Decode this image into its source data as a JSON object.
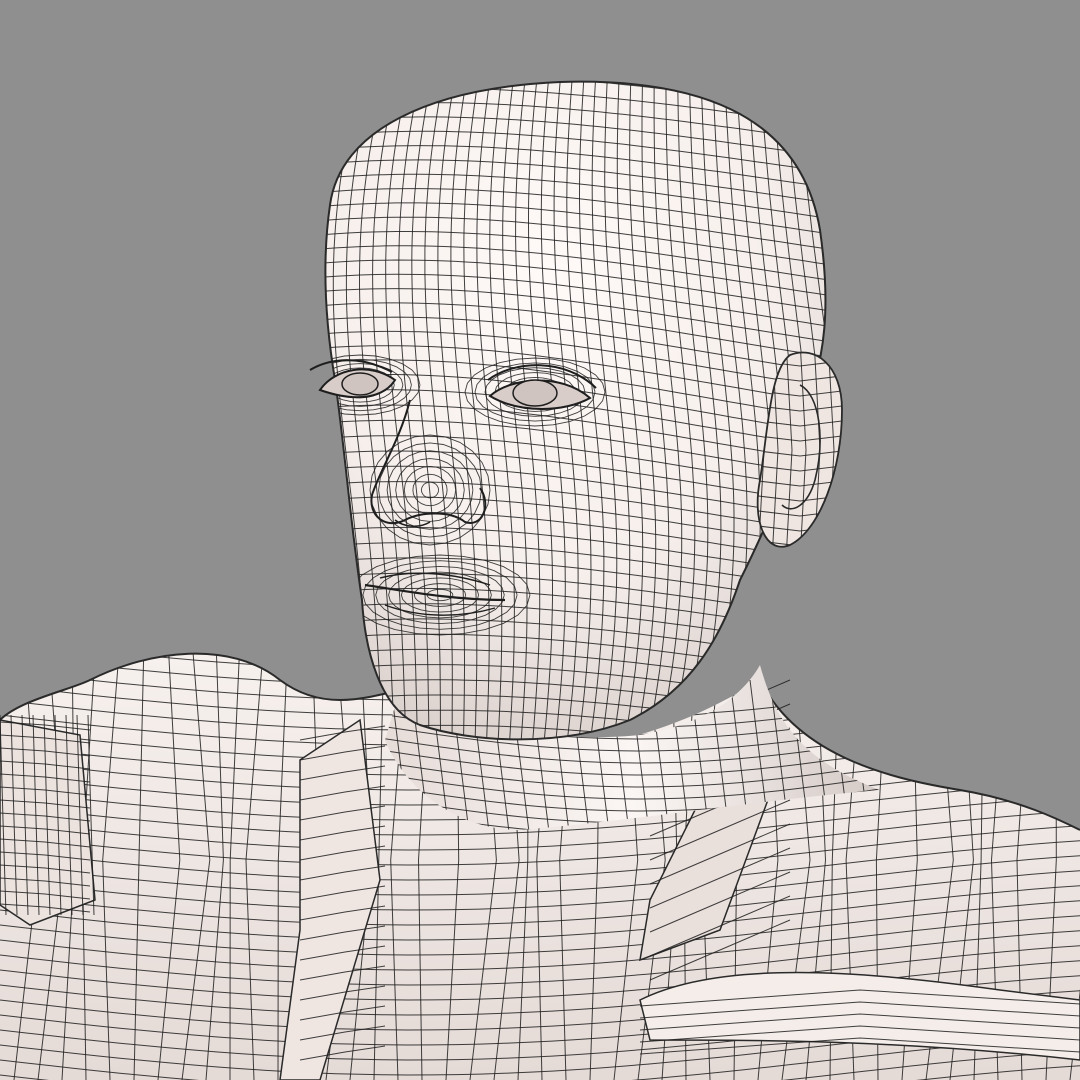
{
  "image": {
    "subject": "",
    "colors": {
      "background": "#8f8f8f",
      "surface_light": "#fbf6f4",
      "surface_shade": "#ddd3cf",
      "surface_dark": "#b9afab",
      "wire": "#1e1e1e"
    }
  }
}
